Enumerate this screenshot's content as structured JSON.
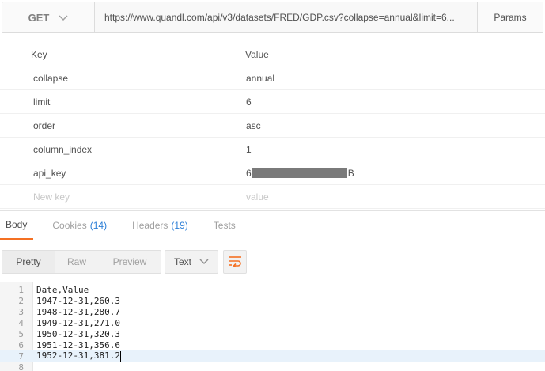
{
  "request": {
    "method": "GET",
    "url": "https://www.quandl.com/api/v3/datasets/FRED/GDP.csv?collapse=annual&limit=6...",
    "params_button": "Params"
  },
  "params": {
    "headers": {
      "key": "Key",
      "value": "Value"
    },
    "rows": [
      {
        "key": "collapse",
        "value": "annual"
      },
      {
        "key": "limit",
        "value": "6"
      },
      {
        "key": "order",
        "value": "asc"
      },
      {
        "key": "column_index",
        "value": "1"
      },
      {
        "key": "api_key",
        "value_prefix": "6",
        "value_suffix": "B"
      }
    ],
    "new_row": {
      "key_placeholder": "New key",
      "value_placeholder": "value"
    }
  },
  "response": {
    "tabs": [
      {
        "label": "Body",
        "count": ""
      },
      {
        "label": "Cookies",
        "count": "(14)"
      },
      {
        "label": "Headers",
        "count": "(19)"
      },
      {
        "label": "Tests",
        "count": ""
      }
    ],
    "active_tab": "Body",
    "toolbar": {
      "views": [
        "Pretty",
        "Raw",
        "Preview"
      ],
      "active_view": "Pretty",
      "format": "Text"
    },
    "lines": [
      {
        "num": "1",
        "text": "Date,Value"
      },
      {
        "num": "2",
        "text": "1947-12-31,260.3"
      },
      {
        "num": "3",
        "text": "1948-12-31,280.7"
      },
      {
        "num": "4",
        "text": "1949-12-31,271.0"
      },
      {
        "num": "5",
        "text": "1950-12-31,320.3"
      },
      {
        "num": "6",
        "text": "1951-12-31,356.6"
      },
      {
        "num": "7",
        "text": "1952-12-31,381.2"
      },
      {
        "num": "8",
        "text": ""
      }
    ],
    "current_line": 7
  },
  "colors": {
    "accent_tab_underline": "#f47023",
    "count_blue": "#2d7fd7",
    "wrap_icon": "#f47023",
    "current_line_bg": "#e8f2fb"
  },
  "icons": {
    "method_dropdown": "chevron-down-icon",
    "format_dropdown": "chevron-down-icon",
    "wrap": "wrap-lines-icon"
  }
}
